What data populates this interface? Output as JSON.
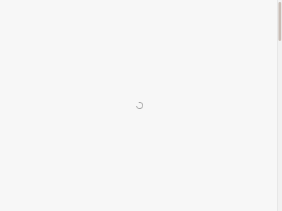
{
  "page": {
    "state": "loading"
  },
  "loading_indicator": {
    "icon": "spinner-icon"
  },
  "colors": {
    "background": "#f7f7f7",
    "spinner": "#8a8a8a",
    "scrollbar_track": "#f1f1f1",
    "scrollbar_thumb": "#c8bdb6"
  }
}
